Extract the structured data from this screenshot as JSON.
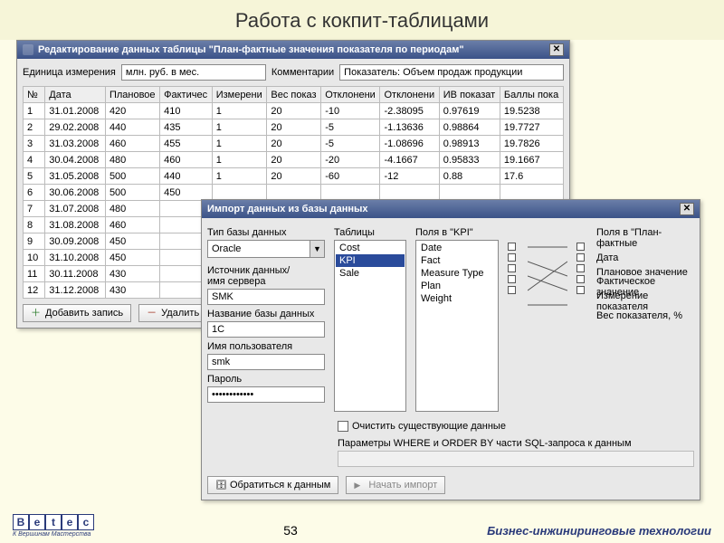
{
  "slide": {
    "title": "Работа с кокпит-таблицами",
    "page_number": "53",
    "footer_company": "Бизнес-инжиниринговые технологии",
    "logo_letters": [
      "B",
      "e",
      "t",
      "e",
      "c"
    ],
    "logo_sub": "К Вершинам Мастерства"
  },
  "win1": {
    "title": "Редактирование данных таблицы  \"План-фактные значения показателя по периодам\"",
    "unit_label": "Единица измерения",
    "unit_value": "млн. руб. в мес.",
    "comment_label": "Комментарии",
    "comment_value": "Показатель: Объем продаж продукции",
    "columns": [
      "№",
      "Дата",
      "Плановое",
      "Фактичес",
      "Измерени",
      "Вес показ",
      "Отклонени",
      "Отклонени",
      "ИВ показат",
      "Баллы пока"
    ],
    "rows": [
      [
        "1",
        "31.01.2008",
        "420",
        "410",
        "1",
        "20",
        "-10",
        "-2.38095",
        "0.97619",
        "19.5238"
      ],
      [
        "2",
        "29.02.2008",
        "440",
        "435",
        "1",
        "20",
        "-5",
        "-1.13636",
        "0.98864",
        "19.7727"
      ],
      [
        "3",
        "31.03.2008",
        "460",
        "455",
        "1",
        "20",
        "-5",
        "-1.08696",
        "0.98913",
        "19.7826"
      ],
      [
        "4",
        "30.04.2008",
        "480",
        "460",
        "1",
        "20",
        "-20",
        "-4.1667",
        "0.95833",
        "19.1667"
      ],
      [
        "5",
        "31.05.2008",
        "500",
        "440",
        "1",
        "20",
        "-60",
        "-12",
        "0.88",
        "17.6"
      ],
      [
        "6",
        "30.06.2008",
        "500",
        "450",
        "",
        "",
        "",
        "",
        "",
        ""
      ],
      [
        "7",
        "31.07.2008",
        "480",
        "",
        "",
        "",
        "",
        "",
        "",
        ""
      ],
      [
        "8",
        "31.08.2008",
        "460",
        "",
        "",
        "",
        "",
        "",
        "",
        ""
      ],
      [
        "9",
        "30.09.2008",
        "450",
        "",
        "",
        "",
        "",
        "",
        "",
        ""
      ],
      [
        "10",
        "31.10.2008",
        "450",
        "",
        "",
        "",
        "",
        "",
        "",
        ""
      ],
      [
        "11",
        "30.11.2008",
        "430",
        "",
        "",
        "",
        "",
        "",
        "",
        ""
      ],
      [
        "12",
        "31.12.2008",
        "430",
        "",
        "",
        "",
        "",
        "",
        "",
        ""
      ]
    ],
    "btn_add": "Добавить запись",
    "btn_del": "Удалить"
  },
  "win2": {
    "title": "Импорт данных из базы данных",
    "db_type_label": "Тип базы данных",
    "db_type_value": "Oracle",
    "source_label_1": "Источник данных/",
    "source_label_2": "имя сервера",
    "source_value": "SMK",
    "db_name_label": "Название базы данных",
    "db_name_value": "1C",
    "user_label": "Имя пользователя",
    "user_value": "smk",
    "password_label": "Пароль",
    "password_value": "••••••••••••",
    "tables_label": "Таблицы",
    "tables": [
      "Cost",
      "KPI",
      "Sale"
    ],
    "tables_selected": "KPI",
    "kpi_fields_label": "Поля в \"KPI\"",
    "kpi_fields": [
      "Date",
      "Fact",
      "Measure Type",
      "Plan",
      "Weight"
    ],
    "plan_fields_label": "Поля в \"План-фактные",
    "plan_fields": [
      "Дата",
      "Плановое значение",
      "Фактическое значение",
      "Измерение показателя",
      "Вес показателя, %"
    ],
    "clear_checkbox": "Очистить существующие данные",
    "where_label": "Параметры WHERE и ORDER BY части SQL-запроса к данным",
    "btn_connect": "Обратиться к данным",
    "btn_import": "Начать импорт"
  }
}
